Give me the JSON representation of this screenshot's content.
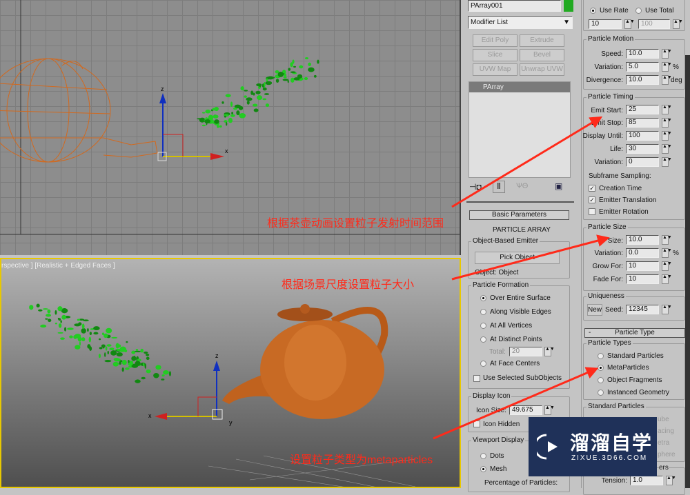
{
  "viewport_bottom": {
    "label": "rspective ] [Realistic + Edged Faces ]"
  },
  "axis": {
    "x": "x",
    "y": "y",
    "z": "z"
  },
  "modify": {
    "object_name": "PArray001",
    "object_color": "#22aa22",
    "modifier_list": "Modifier List",
    "buttons": [
      "Edit Poly",
      "Extrude",
      "Slice",
      "Bevel",
      "UVW Map",
      "Unwrap UVW"
    ],
    "stack": [
      "PArray"
    ]
  },
  "basic": {
    "rollout": "Basic Parameters",
    "title": "PARTICLE ARRAY",
    "emitter_group": "Object-Based Emitter",
    "pick_object": "Pick Object",
    "object": "Object: Object",
    "formation_group": "Particle Formation",
    "formation": [
      {
        "label": "Over Entire Surface",
        "on": true
      },
      {
        "label": "Along Visible Edges",
        "on": false
      },
      {
        "label": "At All Vertices",
        "on": false
      },
      {
        "label": "At Distinct Points",
        "on": false
      },
      {
        "label": "At Face Centers",
        "on": false
      }
    ],
    "total_label": "Total:",
    "total": "20",
    "use_selected": "Use Selected SubObjects",
    "display_icon_group": "Display Icon",
    "icon_size_label": "Icon Size:",
    "icon_size": "49.675",
    "icon_hidden": "Icon Hidden",
    "viewport_group": "Viewport Display",
    "dots": "Dots",
    "mesh": "Mesh",
    "percentage": "Percentage of Particles:"
  },
  "generation": {
    "use_rate": "Use Rate",
    "use_total": "Use Total",
    "rate": "10",
    "total": "100",
    "motion_group": "Particle Motion",
    "speed_label": "Speed:",
    "speed": "10.0",
    "variation_label": "Variation:",
    "variation": "5.0",
    "pct": "%",
    "divergence_label": "Divergence:",
    "divergence": "10.0",
    "deg": "deg",
    "timing_group": "Particle Timing",
    "emit_start_label": "Emit Start:",
    "emit_start": "25",
    "emit_stop_label": "Emit Stop:",
    "emit_stop": "85",
    "display_until_label": "Display Until:",
    "display_until": "100",
    "life_label": "Life:",
    "life": "30",
    "tvar_label": "Variation:",
    "tvar": "0",
    "subframe": "Subframe Sampling:",
    "creation_time": "Creation Time",
    "emitter_translation": "Emitter Translation",
    "emitter_rotation": "Emitter Rotation",
    "size_group": "Particle Size",
    "size_label": "Size:",
    "size": "10.0",
    "svar_label": "Variation:",
    "svar": "0.0",
    "grow_label": "Grow For:",
    "grow": "10",
    "fade_label": "Fade For:",
    "fade": "10",
    "uniq_group": "Uniqueness",
    "new": "New",
    "seed_label": "Seed:",
    "seed": "12345"
  },
  "ptype": {
    "rollout_minus": "-",
    "rollout": "Particle Type",
    "group": "Particle Types",
    "types": [
      {
        "label": "Standard Particles",
        "on": false
      },
      {
        "label": "MetaParticles",
        "on": true
      },
      {
        "label": "Object Fragments",
        "on": false
      },
      {
        "label": "Instanced Geometry",
        "on": false
      }
    ],
    "std_group": "Standard Particles",
    "std_partial": [
      "ube",
      "acing",
      "etra",
      "phere"
    ],
    "meta_partial": "ers",
    "tension_label": "Tension:",
    "tension": "1.0"
  },
  "annotations": [
    "根据茶壶动画设置粒子发射时间范围",
    "根据场景尺度设置粒子大小",
    "设置粒子类型为metaparticles"
  ],
  "watermark": {
    "title": "溜溜自学",
    "url": "ZIXUE.3D66.COM"
  }
}
